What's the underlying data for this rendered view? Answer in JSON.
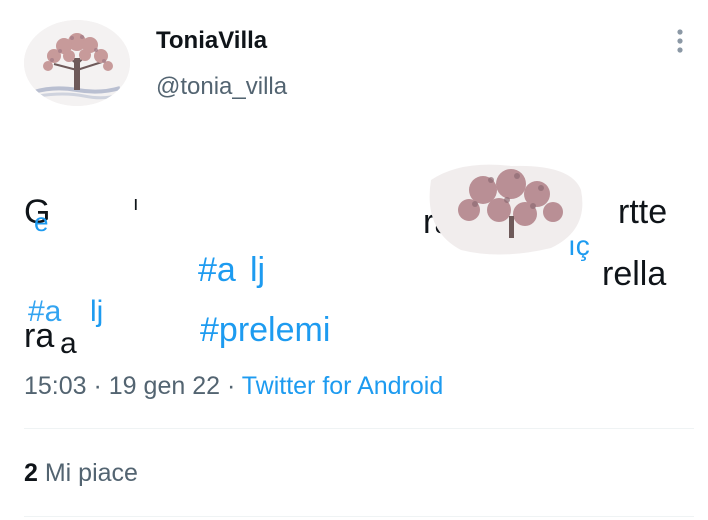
{
  "user": {
    "display_name": "ToniaVilla",
    "handle": "@tonia_villa",
    "avatar_icon": "tree-of-life-icon"
  },
  "tweet": {
    "fragments": [
      "G",
      "e",
      "ı",
      "rtte",
      "rella",
      "ra",
      "rau",
      "ıç",
      "#a",
      "lj",
      "a",
      "#prelemi"
    ],
    "hashtag": "#prelemi"
  },
  "meta": {
    "time": "15:03",
    "separator1": " · ",
    "date": "19 gen 22",
    "separator2": " · ",
    "source": "Twitter for Android"
  },
  "engagement": {
    "likes_count": "2",
    "likes_label": "Mi piace"
  },
  "colors": {
    "text": "#0f1419",
    "secondary": "#536471",
    "accent": "#1d9bf0",
    "divider": "#eff3f4"
  }
}
